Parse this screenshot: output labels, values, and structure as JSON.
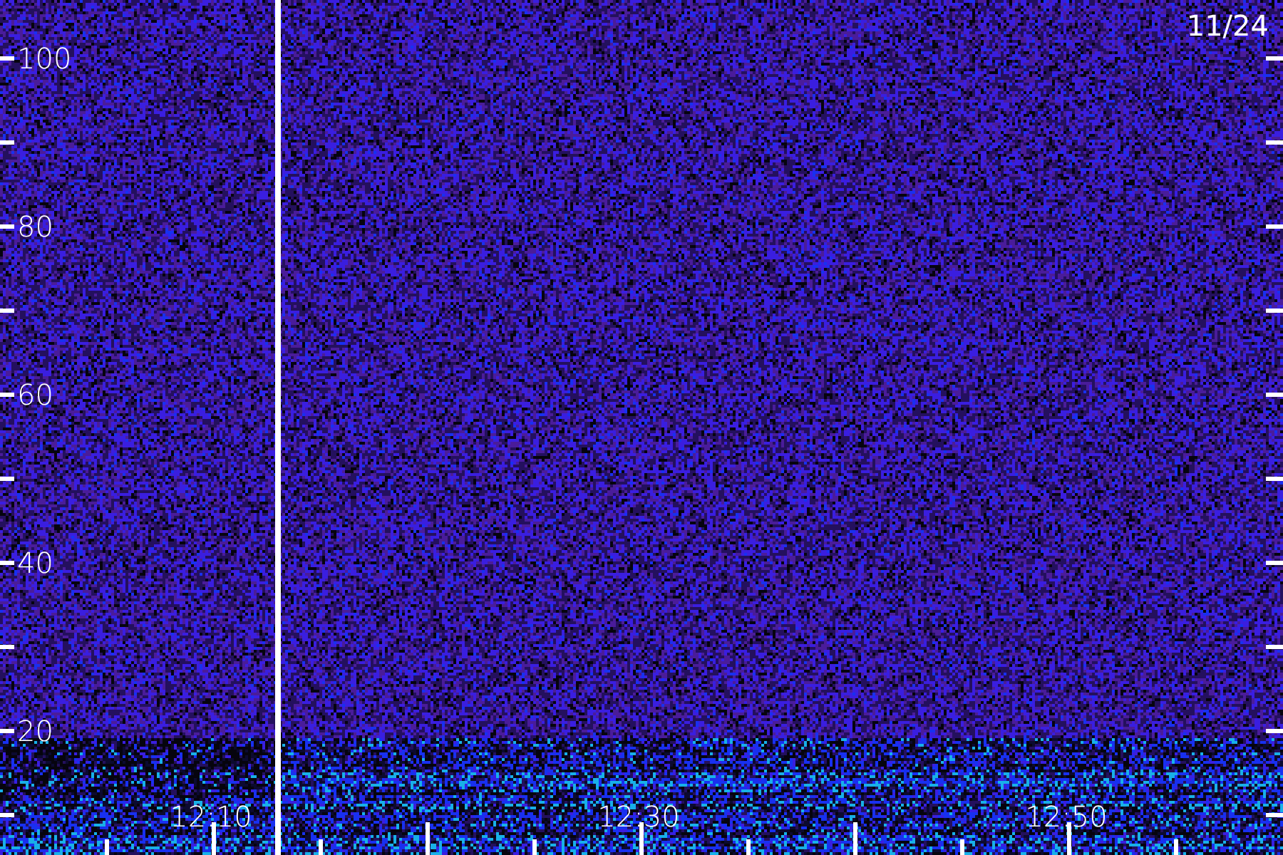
{
  "date_label": "11/24",
  "y_axis": {
    "labels": [
      "100",
      "80",
      "60",
      "40",
      "20"
    ]
  },
  "x_axis": {
    "labels": [
      "12:10",
      "12:30",
      "12:50"
    ]
  }
}
